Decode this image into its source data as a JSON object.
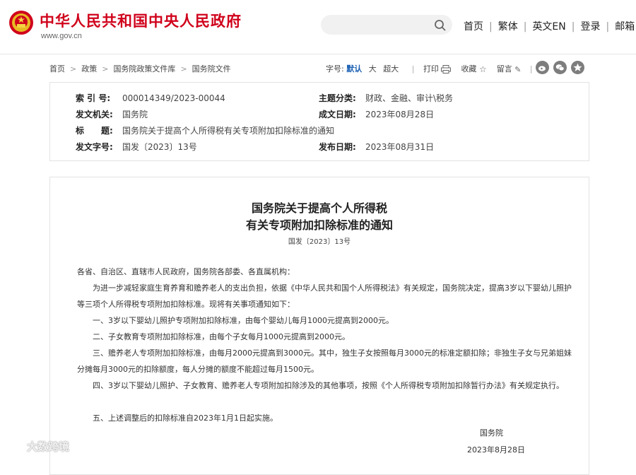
{
  "header": {
    "site_title": "中华人民共和国中央人民政府",
    "site_domain": "www.gov.cn",
    "search_placeholder": "",
    "nav": [
      "首页",
      "繁体",
      "英文EN",
      "登录",
      "邮箱"
    ]
  },
  "breadcrumb": [
    "首页",
    "政策",
    "国务院政策文件库",
    "国务院文件"
  ],
  "tools": {
    "font_label": "字号:",
    "sizes": [
      "默认",
      "大",
      "超大"
    ],
    "print": "打印",
    "favorite": "收藏",
    "comment": "留言"
  },
  "meta": {
    "index_label": "索 引 号:",
    "index_value": "000014349/2023-00044",
    "category_label": "主题分类:",
    "category_value": "财政、金融、审计\\税务",
    "issuer_label": "发文机关:",
    "issuer_value": "国务院",
    "written_label": "成文日期:",
    "written_value": "2023年08月28日",
    "title_label": "标　　题:",
    "title_value": "国务院关于提高个人所得税有关专项附加扣除标准的通知",
    "docno_label": "发文字号:",
    "docno_value": "国发〔2023〕13号",
    "published_label": "发布日期:",
    "published_value": "2023年08月31日"
  },
  "article": {
    "title_line1": "国务院关于提高个人所得税",
    "title_line2": "有关专项附加扣除标准的通知",
    "doc_number": "国发〔2023〕13号",
    "salutation": "各省、自治区、直辖市人民政府，国务院各部委、各直属机构：",
    "paragraphs": [
      "为进一步减轻家庭生育养育和赡养老人的支出负担，依据《中华人民共和国个人所得税法》有关规定，国务院决定，提高3岁以下婴幼儿照护等三项个人所得税专项附加扣除标准。现将有关事项通知如下：",
      "一、3岁以下婴幼儿照护专项附加扣除标准，由每个婴幼儿每月1000元提高到2000元。",
      "二、子女教育专项附加扣除标准，由每个子女每月1000元提高到2000元。",
      "三、赡养老人专项附加扣除标准，由每月2000元提高到3000元。其中，独生子女按照每月3000元的标准定额扣除；非独生子女与兄弟姐妹分摊每月3000元的扣除额度，每人分摊的额度不能超过每月1500元。",
      "四、3岁以下婴幼儿照护、子女教育、赡养老人专项附加扣除涉及的其他事项，按照《个人所得税专项附加扣除暂行办法》有关规定执行。",
      "五、上述调整后的扣除标准自2023年1月1日起实施。"
    ],
    "signature": "国务院",
    "date": "2023年8月28日"
  },
  "watermark": "大数跨境",
  "colors": {
    "brand_red": "#d0021b",
    "link_blue": "#1a5fb4"
  }
}
